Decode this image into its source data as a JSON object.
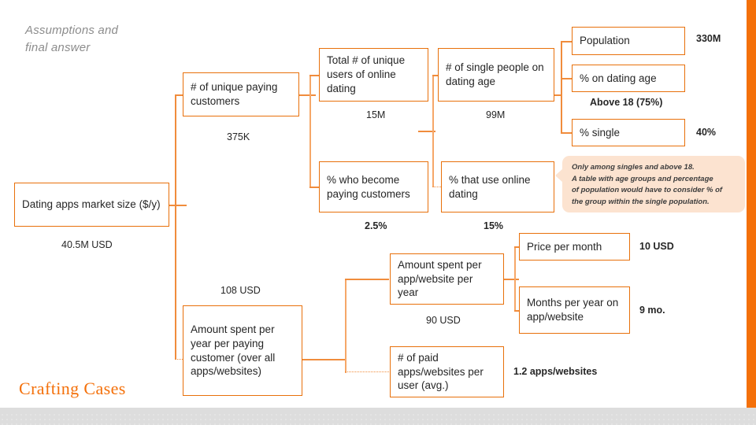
{
  "slide": {
    "title": "Assumptions and\nfinal answer",
    "brand": "Crafting Cases",
    "accent_color": "#F4700A",
    "box_border_color": "#E8700A",
    "connector_color": "#F08C3C",
    "callout_bg_color": "#FCE3D0",
    "title_color": "#8C8C8C",
    "footer_color": "#DDDDDD"
  },
  "tree": {
    "root": {
      "label": "Dating apps market size ($/y)",
      "value": "40.5M USD",
      "value_bold": false
    },
    "level2": [
      {
        "label": "# of unique paying customers",
        "value": "375K",
        "value_bold": false
      },
      {
        "label": "Amount spent per year per paying customer (over all apps/websites)",
        "value": "108 USD",
        "value_bold": false
      }
    ],
    "level3_top": [
      {
        "label": "Total # of unique users of online dating",
        "value": "15M",
        "value_bold": false
      },
      {
        "label": "% who become paying customers",
        "value": "2.5%",
        "value_bold": true
      }
    ],
    "level4_top": [
      {
        "label": "# of single people on dating age",
        "value": "99M",
        "value_bold": false
      },
      {
        "label": "% that use online dating",
        "value": "15%",
        "value_bold": true
      }
    ],
    "level5_top": [
      {
        "label": "Population",
        "value": "330M",
        "value_bold": true
      },
      {
        "label": "% on dating age",
        "value": "Above 18 (75%)",
        "value_bold": true
      },
      {
        "label": "% single",
        "value": "40%",
        "value_bold": true
      }
    ],
    "level3_bottom": [
      {
        "label": "Amount spent per app/website per year",
        "value": "90 USD",
        "value_bold": false
      },
      {
        "label": "# of paid apps/websites per user (avg.)",
        "value": "1.2 apps/websites",
        "value_bold": true
      }
    ],
    "level4_bottom": [
      {
        "label": "Price per month",
        "value": "10 USD",
        "value_bold": true
      },
      {
        "label": "Months per year on app/website",
        "value": "9 mo.",
        "value_bold": true
      }
    ]
  },
  "callout": {
    "line1": "Only among singles and above 18.",
    "line2": "A table with age groups and percentage",
    "line3": "of population would have to consider % of",
    "line4": "the group within the single population."
  }
}
